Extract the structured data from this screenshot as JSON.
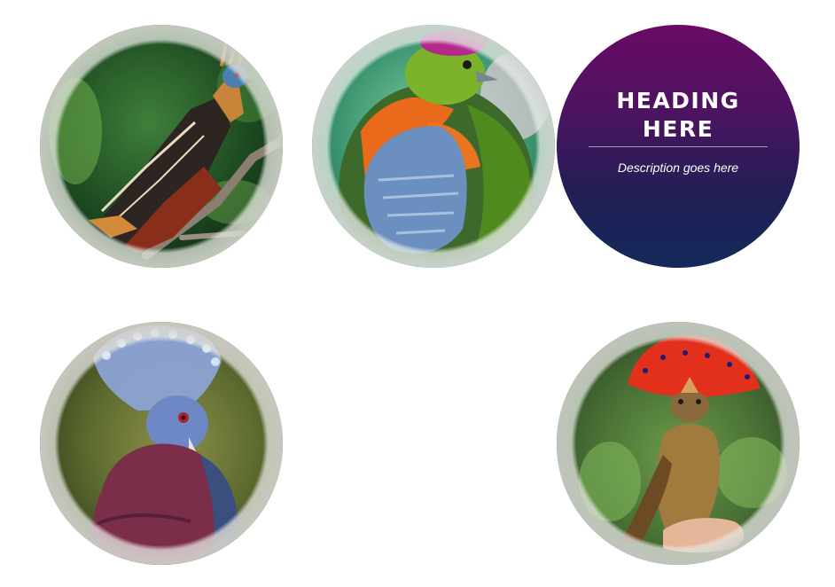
{
  "gallery": {
    "items": [
      {
        "subject": "hoatzin-bird",
        "icon": "bird-photo-icon"
      },
      {
        "subject": "fruit-dove-bird",
        "icon": "bird-photo-icon"
      },
      {
        "subject": "caption-card",
        "icon": ""
      },
      {
        "subject": "crowned-pigeon-bird",
        "icon": "bird-photo-icon"
      },
      {
        "subject": "royal-flycatcher-bird",
        "icon": "bird-photo-icon"
      }
    ],
    "caption": {
      "heading": "Heading Here",
      "description": "Description goes here"
    }
  },
  "colors": {
    "caption_top": "#6a0a64",
    "caption_bottom": "#13295a",
    "ring": "#d9dcd6"
  }
}
